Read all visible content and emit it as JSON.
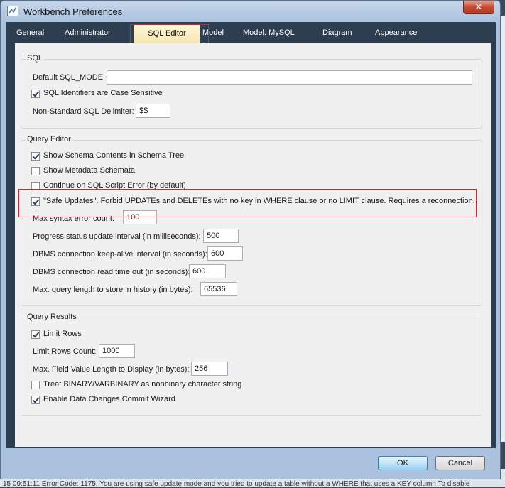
{
  "window": {
    "title": "Workbench Preferences",
    "close_glyph": "✕"
  },
  "tabs": [
    {
      "label": "General"
    },
    {
      "label": "Administrator"
    },
    {
      "label": "SQL Editor",
      "active": true
    },
    {
      "label": "Model"
    },
    {
      "label": "Model: MySQL"
    },
    {
      "label": "Diagram"
    },
    {
      "label": "Appearance"
    }
  ],
  "sql_group": {
    "title": "SQL",
    "default_sql_mode_label": "Default SQL_MODE:",
    "default_sql_mode_value": "",
    "case_sensitive_label": "SQL Identifiers are Case Sensitive",
    "case_sensitive_checked": true,
    "delimiter_label": "Non-Standard SQL Delimiter:",
    "delimiter_value": "$$"
  },
  "query_editor": {
    "title": "Query Editor",
    "show_schema_contents_label": "Show Schema Contents in Schema Tree",
    "show_schema_contents_checked": true,
    "show_metadata_label": "Show Metadata Schemata",
    "show_metadata_checked": false,
    "continue_on_error_label": "Continue on SQL Script Error (by default)",
    "continue_on_error_checked": false,
    "safe_updates_label": "\"Safe Updates\". Forbid UPDATEs and DELETEs with no key in WHERE clause or no LIMIT clause. Requires a reconnection.",
    "safe_updates_checked": true,
    "max_syntax_error_label": "Max syntax error count:",
    "max_syntax_error_value": "100",
    "progress_interval_label": "Progress status update interval (in milliseconds):",
    "progress_interval_value": "500",
    "keepalive_label": "DBMS connection keep-alive interval (in seconds):",
    "keepalive_value": "600",
    "read_timeout_label": "DBMS connection read time out (in seconds):",
    "read_timeout_value": "600",
    "max_query_length_label": "Max. query length to store in history (in bytes):",
    "max_query_length_value": "65536"
  },
  "query_results": {
    "title": "Query Results",
    "limit_rows_label": "Limit Rows",
    "limit_rows_checked": true,
    "limit_rows_count_label": "Limit Rows Count:",
    "limit_rows_count_value": "1000",
    "max_field_length_label": "Max. Field Value Length to Display (in bytes):",
    "max_field_length_value": "256",
    "treat_binary_label": "Treat BINARY/VARBINARY as nonbinary character string",
    "treat_binary_checked": false,
    "commit_wizard_label": "Enable Data Changes Commit Wizard",
    "commit_wizard_checked": true
  },
  "buttons": {
    "ok": "OK",
    "cancel": "Cancel"
  },
  "background": {
    "status_text": "15 09:51:11     Error Code: 1175. You are using safe update mode and you tried to update a table without a WHERE that uses a KEY column To disable"
  }
}
